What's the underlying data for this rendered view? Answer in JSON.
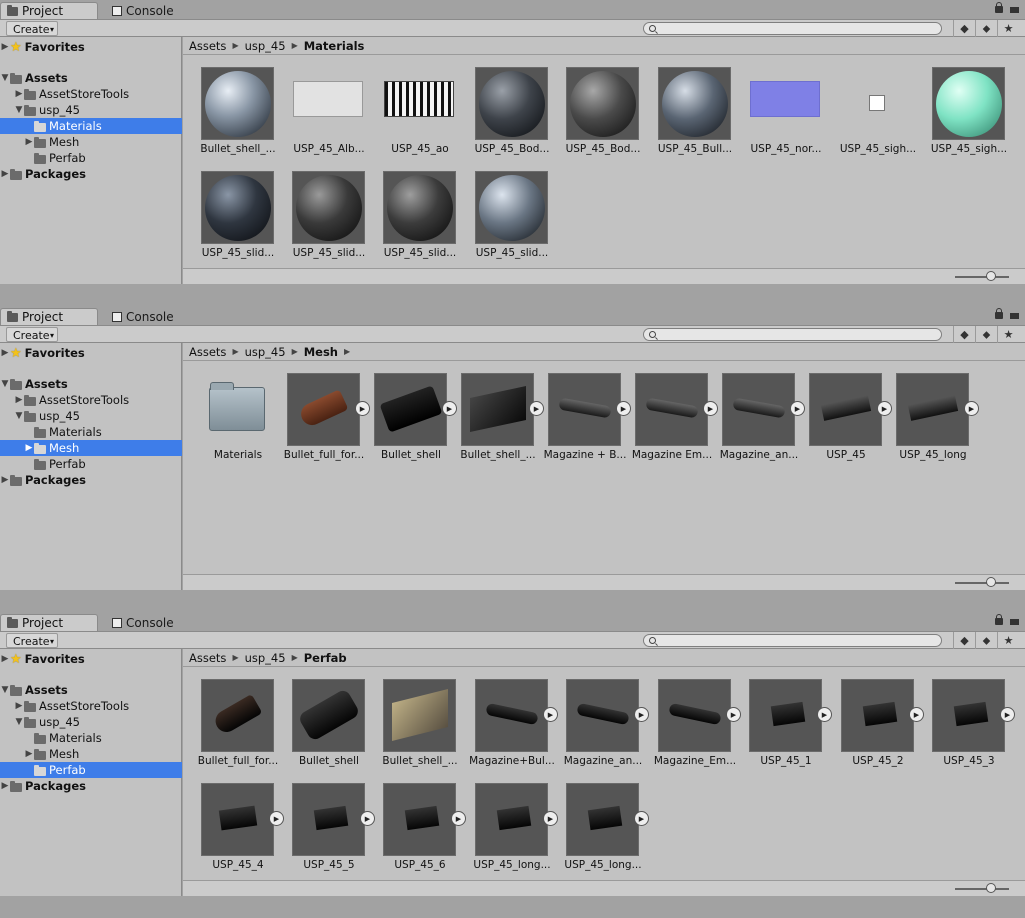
{
  "tabs": {
    "project": "Project",
    "console": "Console"
  },
  "toolbar": {
    "create": "Create"
  },
  "tree": {
    "favorites": "Favorites",
    "assets": "Assets",
    "asset_store_tools": "AssetStoreTools",
    "usp_45": "usp_45",
    "materials": "Materials",
    "mesh": "Mesh",
    "perfab": "Perfab",
    "packages": "Packages"
  },
  "panels": [
    {
      "crumbs": [
        "Assets",
        "usp_45",
        "Materials"
      ],
      "selected": "Materials",
      "items": [
        "Bullet_shell_...",
        "USP_45_Alb...",
        "USP_45_ao",
        "USP_45_Bod...",
        "USP_45_Bod...",
        "USP_45_Bull...",
        "USP_45_nor...",
        "USP_45_sigh...",
        "USP_45_sigh...",
        "USP_45_slid...",
        "USP_45_slid...",
        "USP_45_slid...",
        "USP_45_slid..."
      ]
    },
    {
      "crumbs": [
        "Assets",
        "usp_45",
        "Mesh"
      ],
      "selected": "Mesh",
      "items": [
        "Materials",
        "Bullet_full_for...",
        "Bullet_shell",
        "Bullet_shell_...",
        "Magazine + B...",
        "Magazine Em...",
        "Magazine_an...",
        "USP_45",
        "USP_45_long"
      ]
    },
    {
      "crumbs": [
        "Assets",
        "usp_45",
        "Perfab"
      ],
      "selected": "Perfab",
      "items": [
        "Bullet_full_for...",
        "Bullet_shell",
        "Bullet_shell_...",
        "Magazine+Bul...",
        "Magazine_an...",
        "Magazine_Em...",
        "USP_45_1",
        "USP_45_2",
        "USP_45_3",
        "USP_45_4",
        "USP_45_5",
        "USP_45_6",
        "USP_45_long...",
        "USP_45_long..."
      ]
    }
  ],
  "icons": [
    "folder-icon",
    "console-icon",
    "lock-icon",
    "menu-icon",
    "search-icon",
    "filter-by-type-icon",
    "filter-by-label-icon",
    "star-icon",
    "play-icon"
  ],
  "colors": {
    "selection": "#3e7de9",
    "panel_bg": "#c2c2c2",
    "toolbar_bg": "#cbcbcb"
  }
}
